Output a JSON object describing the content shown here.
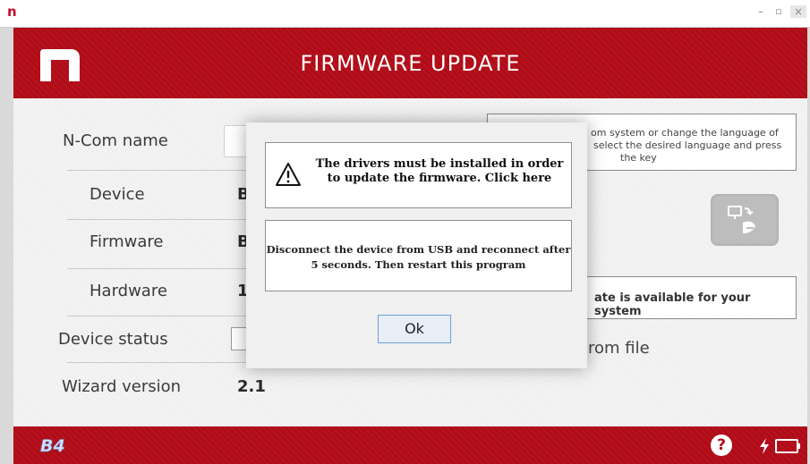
{
  "window": {
    "app_icon": "n",
    "minimize_icon": "minimize-icon",
    "maximize_icon": "maximize-icon",
    "close_icon": "close-icon"
  },
  "header": {
    "title": "FIRMWARE UPDATE",
    "logo_icon": "n-com-logo-icon",
    "accent_color": "#b00b17"
  },
  "fields": {
    "ncom_name_label": "N-Com name",
    "device_label": "Device",
    "device_value": "B",
    "firmware_label": "Firmware",
    "firmware_value": "B",
    "hardware_label": "Hardware",
    "hardware_value": "1",
    "device_status_label": "Device status",
    "wizard_version_label": "Wizard version",
    "wizard_version_value": "2.1"
  },
  "right_panel": {
    "info_line1": "om system or change the language of",
    "info_line2": "select the desired language and press",
    "info_line3": "the key",
    "language_button_icon": "language-sync-icon",
    "update_text": "ate is available for your system",
    "from_file_text": "rom file"
  },
  "modal": {
    "warning_icon": "warning-icon",
    "drivers_message": "The drivers must be installed in order to update the firmware. Click here",
    "disconnect_message": "Disconnect the device from USB and reconnect after 5 seconds. Then restart this program",
    "ok_label": "Ok"
  },
  "footer": {
    "product_logo": "B4",
    "help_icon": "help-icon",
    "help_glyph": "?",
    "bolt_icon": "charging-bolt-icon",
    "battery_icon": "battery-icon"
  }
}
